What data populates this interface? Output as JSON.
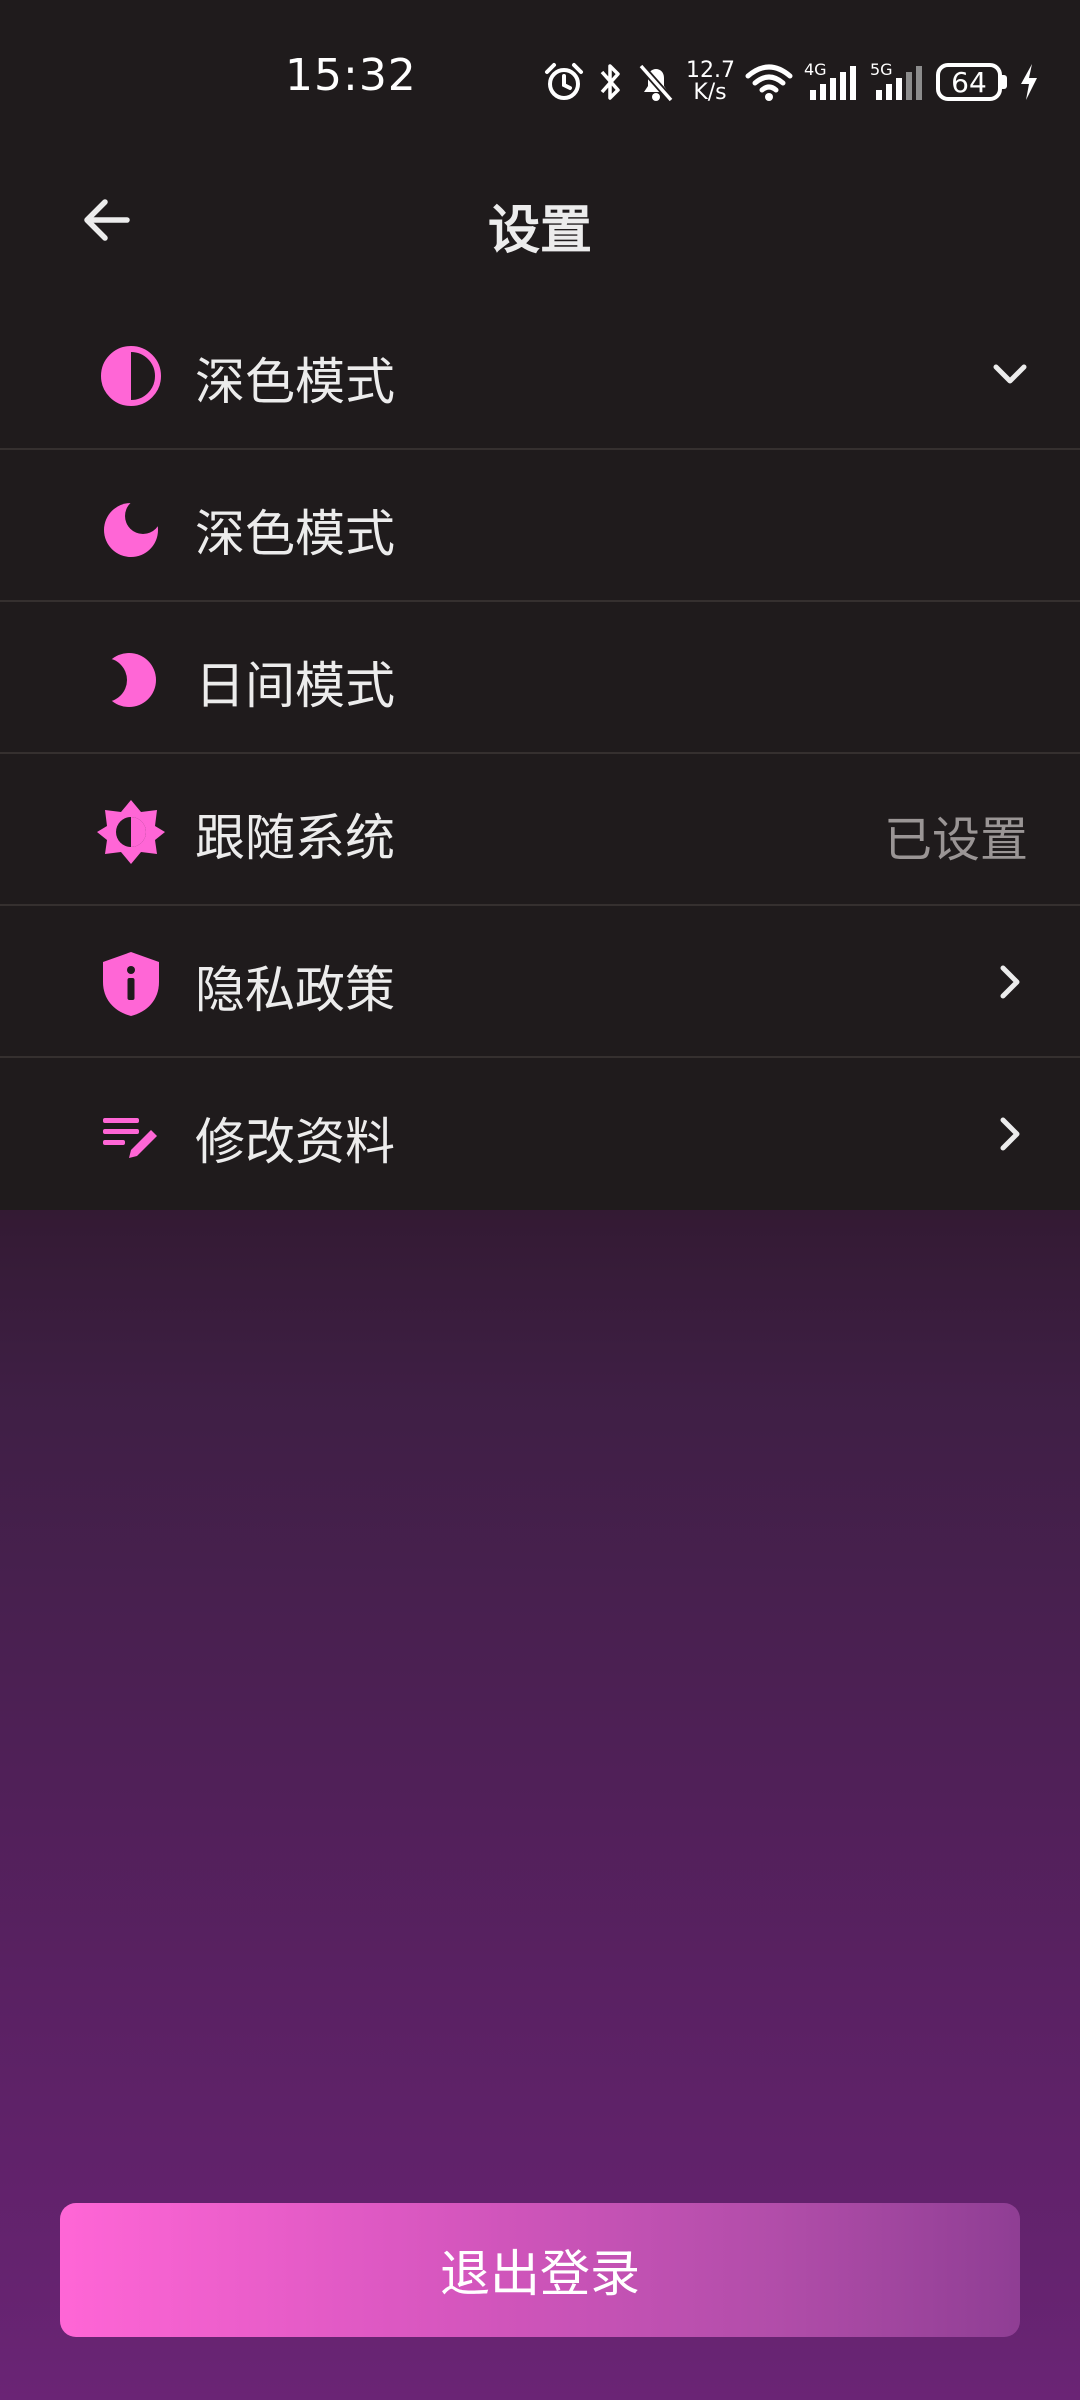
{
  "status_bar": {
    "time": "15:32",
    "net_speed_value": "12.7",
    "net_speed_unit": "K/s",
    "network_4g": "4G",
    "network_5g": "5G",
    "battery": "64",
    "icons": [
      "alarm-icon",
      "bluetooth-icon",
      "mute-icon",
      "wifi-icon",
      "signal-4g-icon",
      "signal-5g-icon",
      "battery-icon",
      "charging-icon"
    ]
  },
  "header": {
    "title": "设置",
    "back_icon": "arrow-left-icon"
  },
  "settings": {
    "items": [
      {
        "label": "深色模式",
        "icon": "contrast-icon",
        "trailing": "chevron-down-icon"
      },
      {
        "label": "深色模式",
        "icon": "moon-icon"
      },
      {
        "label": "日间模式",
        "icon": "crescent-icon"
      },
      {
        "label": "跟随系统",
        "icon": "brightness-auto-icon",
        "status": "已设置"
      },
      {
        "label": "隐私政策",
        "icon": "privacy-shield-icon",
        "trailing": "chevron-right-icon"
      },
      {
        "label": "修改资料",
        "icon": "edit-profile-icon",
        "trailing": "chevron-right-icon"
      }
    ]
  },
  "logout": {
    "label": "退出登录"
  },
  "colors": {
    "accent": "#ff66d6",
    "surface": "#1f1b1c",
    "divider": "#35302f",
    "text_primary": "#ececec",
    "text_secondary": "#9a9595",
    "background_bottom": "#6a2475"
  }
}
